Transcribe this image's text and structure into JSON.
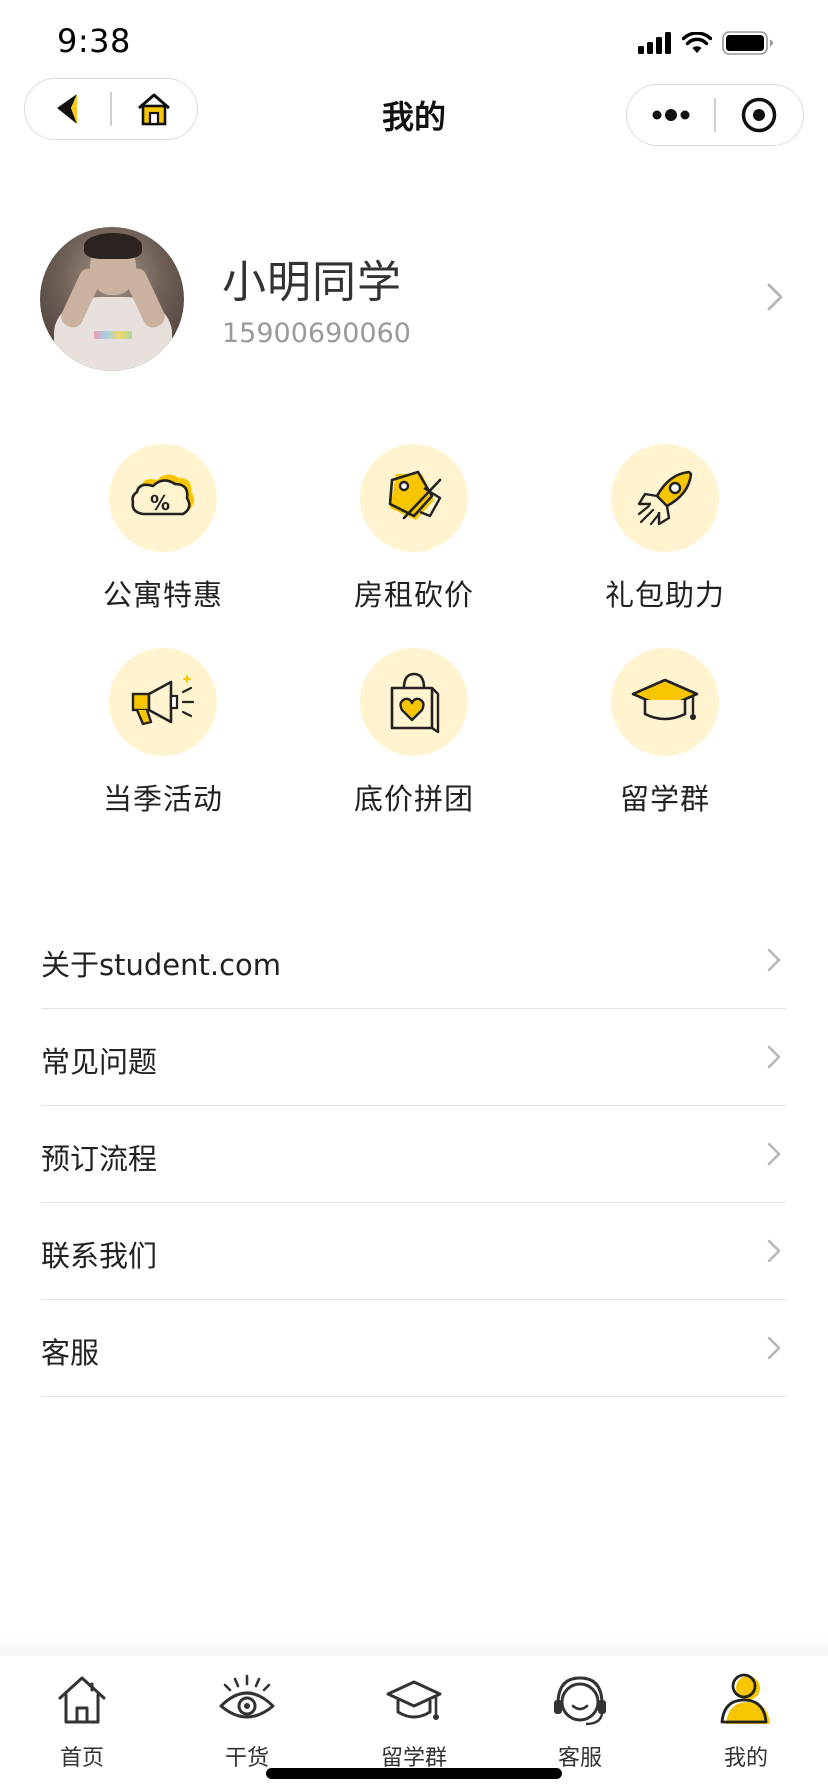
{
  "status_bar": {
    "time": "9:38"
  },
  "nav": {
    "title": "我的"
  },
  "profile": {
    "name": "小明同学",
    "phone": "15900690060"
  },
  "features": [
    {
      "label": "公寓特惠",
      "icon": "coupon-percent-icon"
    },
    {
      "label": "房租砍价",
      "icon": "price-tag-cut-icon"
    },
    {
      "label": "礼包助力",
      "icon": "rocket-icon"
    },
    {
      "label": "当季活动",
      "icon": "megaphone-icon"
    },
    {
      "label": "底价拼团",
      "icon": "shopping-bag-heart-icon"
    },
    {
      "label": "留学群",
      "icon": "graduation-cap-icon"
    }
  ],
  "menu": [
    {
      "label": "关于student.com"
    },
    {
      "label": "常见问题"
    },
    {
      "label": "预订流程"
    },
    {
      "label": "联系我们"
    },
    {
      "label": "客服"
    }
  ],
  "tabs": [
    {
      "label": "首页",
      "icon": "home-icon"
    },
    {
      "label": "干货",
      "icon": "eye-icon"
    },
    {
      "label": "留学群",
      "icon": "graduation-cap-icon"
    },
    {
      "label": "客服",
      "icon": "headset-icon"
    },
    {
      "label": "我的",
      "icon": "user-icon",
      "active": true
    }
  ],
  "colors": {
    "accent": "#f7c600",
    "accent_light": "#fff4cf",
    "divider": "#e2e2e2"
  }
}
